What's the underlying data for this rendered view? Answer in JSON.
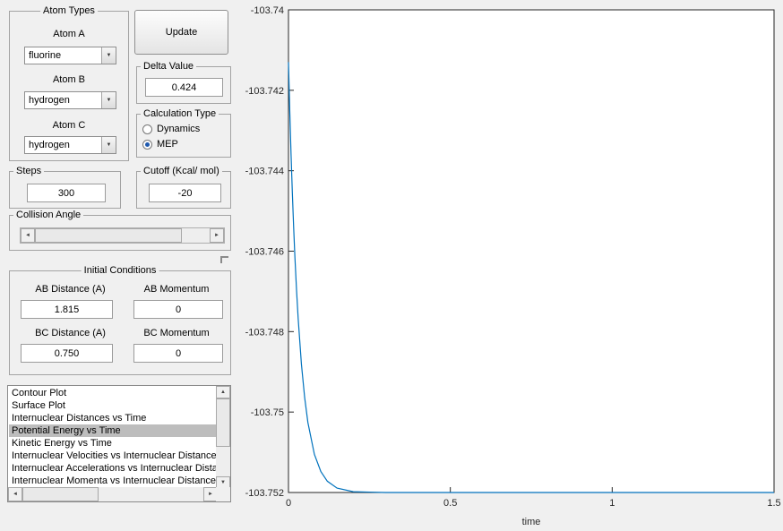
{
  "colors": {
    "bg": "#f0f0f0",
    "line": "#0072bd",
    "selection": "#bdbdbd"
  },
  "icons": {
    "dropdown_arrow": "▼",
    "scroll_left": "◄",
    "scroll_right": "►",
    "scroll_up": "▲",
    "scroll_down": "▼"
  },
  "panels": {
    "atom_types": {
      "title": "Atom Types",
      "atoms": [
        {
          "label": "Atom A",
          "value": "fluorine"
        },
        {
          "label": "Atom B",
          "value": "hydrogen"
        },
        {
          "label": "Atom C",
          "value": "hydrogen"
        }
      ]
    },
    "update_button_label": "Update",
    "delta_value": {
      "title": "Delta Value",
      "value": "0.424"
    },
    "calculation_type": {
      "title": "Calculation Type",
      "options": [
        {
          "label": "Dynamics",
          "selected": false
        },
        {
          "label": "MEP",
          "selected": true
        }
      ]
    },
    "steps": {
      "title": "Steps",
      "value": "300"
    },
    "cutoff": {
      "title": "Cutoff (Kcal/ mol)",
      "value": "-20"
    },
    "collision_angle": {
      "title": "Collision Angle"
    },
    "initial_conditions": {
      "title": "Initial Conditions",
      "fields": [
        {
          "label": "AB Distance (A)",
          "value": "1.815"
        },
        {
          "label": "AB Momentum",
          "value": "0"
        },
        {
          "label": "BC Distance (A)",
          "value": "0.750"
        },
        {
          "label": "BC Momentum",
          "value": "0"
        }
      ]
    }
  },
  "plot_list": {
    "selected_index": 3,
    "selected_item": "Potential Energy vs Time",
    "items": [
      "Contour Plot",
      "Surface Plot",
      "Internuclear Distances vs Time",
      "Potential Energy vs Time",
      "Kinetic Energy vs Time",
      "Internuclear Velocities vs Internuclear Distance",
      "Internuclear Accelerations vs Internuclear Distance",
      "Internuclear Momenta vs Internuclear Distance"
    ]
  },
  "chart_data": {
    "type": "line",
    "title": "",
    "xlabel": "time",
    "ylabel": "",
    "xlim": [
      0,
      1.5
    ],
    "ylim": [
      -103.752,
      -103.74
    ],
    "grid": false,
    "legend": false,
    "xticks": [
      0,
      0.5,
      1,
      1.5
    ],
    "xtick_labels": [
      "0",
      "0.5",
      "1",
      "1.5"
    ],
    "yticks": [
      -103.74,
      -103.742,
      -103.744,
      -103.746,
      -103.748,
      -103.75,
      -103.752
    ],
    "ytick_labels": [
      "-103.74",
      "-103.742",
      "-103.744",
      "-103.746",
      "-103.748",
      "-103.75",
      "-103.752"
    ],
    "series": [
      {
        "name": "Potential Energy vs Time",
        "color": "#0072bd",
        "x": [
          0,
          0.004,
          0.008,
          0.012,
          0.016,
          0.02,
          0.025,
          0.03,
          0.04,
          0.05,
          0.06,
          0.08,
          0.1,
          0.12,
          0.15,
          0.2,
          0.25,
          0.3,
          0.4,
          0.6,
          0.8,
          1.0,
          1.25,
          1.5
        ],
        "y": [
          -103.7413,
          -103.74252,
          -103.7436,
          -103.74456,
          -103.74541,
          -103.74617,
          -103.74698,
          -103.74768,
          -103.74881,
          -103.74964,
          -103.75026,
          -103.75105,
          -103.75148,
          -103.75172,
          -103.75189,
          -103.75198,
          -103.75199,
          -103.752,
          -103.752,
          -103.752,
          -103.752,
          -103.752,
          -103.752,
          -103.752
        ]
      }
    ]
  }
}
